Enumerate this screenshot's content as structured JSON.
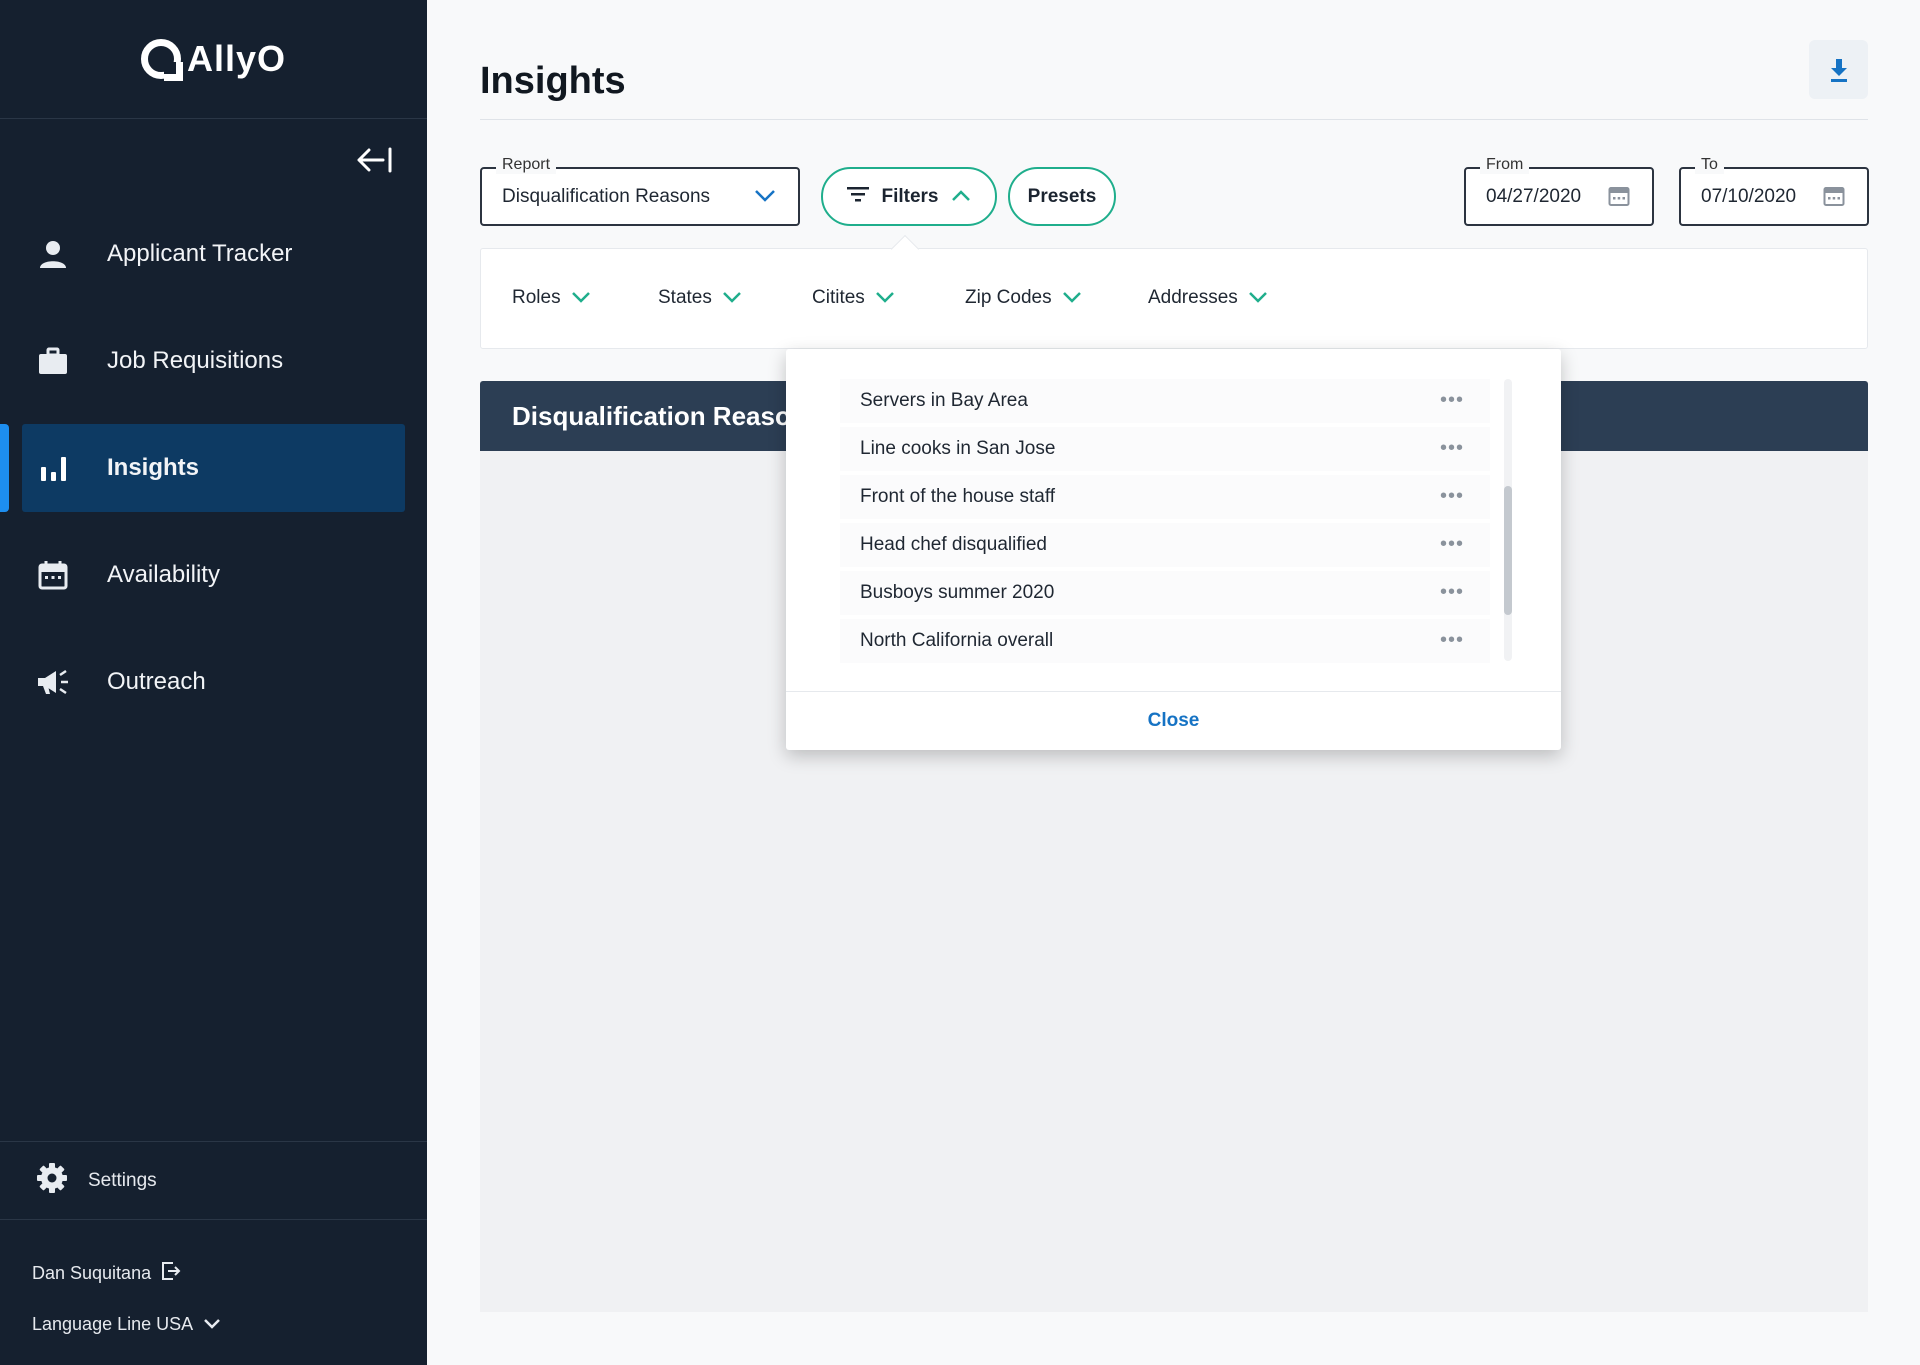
{
  "app": {
    "logo_text": "AllyO",
    "accent": "#1d8ef0",
    "sidebar_bg": "#15202f",
    "teal": "#1fae8c"
  },
  "sidebar": {
    "items": [
      {
        "label": "Applicant Tracker",
        "icon": "person-icon"
      },
      {
        "label": "Job Requisitions",
        "icon": "briefcase-icon"
      },
      {
        "label": "Insights",
        "icon": "bar-chart-icon",
        "active": true
      },
      {
        "label": "Availability",
        "icon": "calendar-icon"
      },
      {
        "label": "Outreach",
        "icon": "megaphone-icon"
      }
    ],
    "settings_label": "Settings",
    "user_name": "Dan Suquitana",
    "org_name": "Language Line USA"
  },
  "page": {
    "title": "Insights"
  },
  "report_select": {
    "legend": "Report",
    "value": "Disqualification Reasons"
  },
  "buttons": {
    "filters": "Filters",
    "presets": "Presets",
    "close": "Close"
  },
  "date_from": {
    "legend": "From",
    "value": "04/27/2020"
  },
  "date_to": {
    "legend": "To",
    "value": "07/10/2020"
  },
  "filters": [
    "Roles",
    "States",
    "Citites",
    "Zip Codes",
    "Addresses"
  ],
  "report_panel": {
    "title": "Disqualification Reasons"
  },
  "presets": [
    "Servers in Bay Area",
    "Line cooks in San Jose",
    "Front of the house staff",
    "Head chef disqualified",
    "Busboys summer 2020",
    "North California overall"
  ],
  "more_glyph": "•••"
}
